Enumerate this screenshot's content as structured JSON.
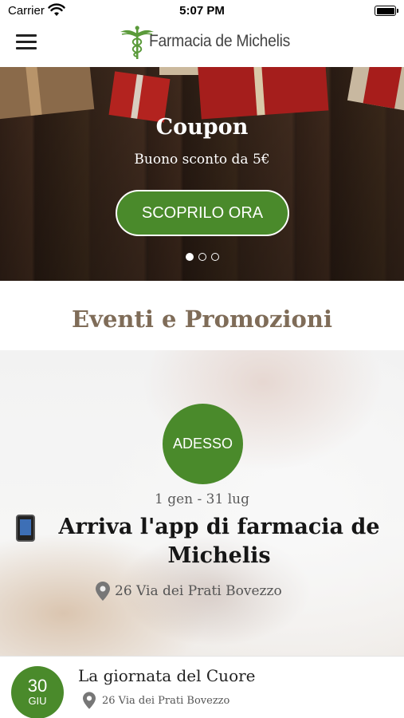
{
  "status_bar": {
    "carrier": "Carrier",
    "time": "5:07 PM"
  },
  "nav": {
    "brand": "Farmacia de Michelis",
    "menu_icon": "hamburger-menu-icon",
    "logo_icon": "caduceus-icon"
  },
  "hero": {
    "title": "Coupon",
    "subtitle": "Buono sconto da 5€",
    "cta_label": "SCOPRILO ORA",
    "slides_total": 3,
    "active_slide": 1
  },
  "events_section": {
    "title": "Eventi e Promozioni"
  },
  "featured_event": {
    "badge": "ADESSO",
    "dates": "1 gen - 31 lug",
    "headline": "Arriva l'app di farmacia de Michelis",
    "address": "26 Via dei Prati Bovezzo",
    "icon": "mobile-phone-icon"
  },
  "list_event": {
    "day": "30",
    "month": "GIU",
    "title": "La giornata del Cuore",
    "address": "26 Via dei Prati Bovezzo"
  },
  "colors": {
    "accent_green": "#4a8a2b",
    "heading_brown": "#7f6c58"
  }
}
